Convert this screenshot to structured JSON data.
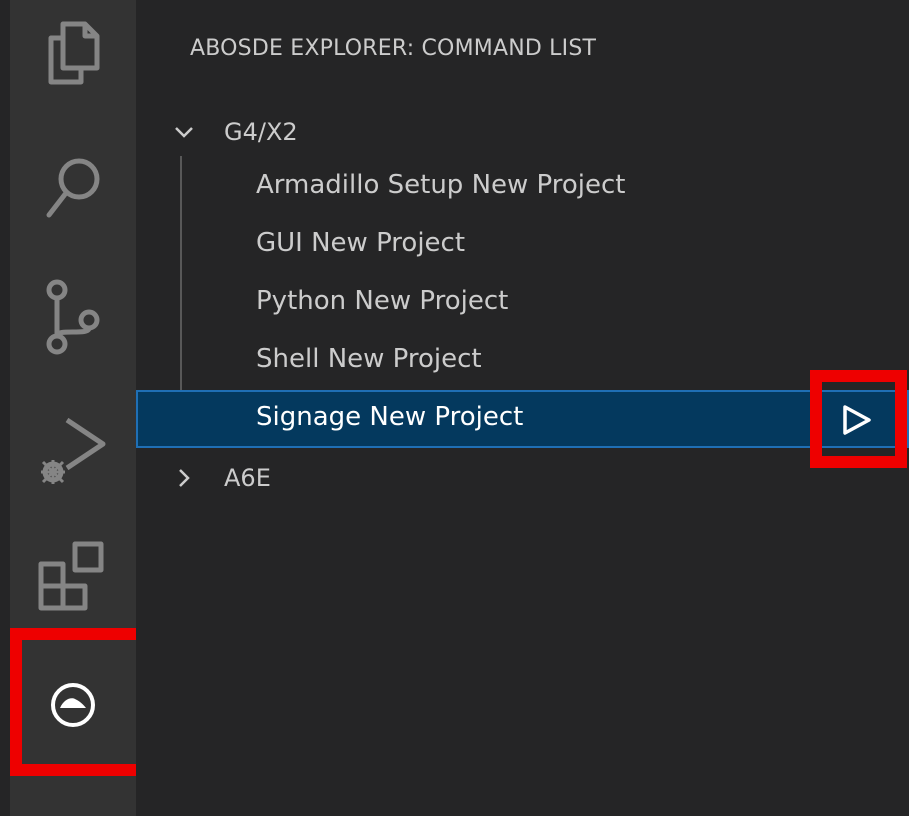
{
  "activity_bar": {
    "items": [
      {
        "icon": "explorer-icon"
      },
      {
        "icon": "search-icon"
      },
      {
        "icon": "source-control-icon"
      },
      {
        "icon": "run-debug-icon"
      },
      {
        "icon": "extensions-icon"
      },
      {
        "icon": "abosde-icon"
      }
    ]
  },
  "sidebar": {
    "title": "ABOSDE EXPLORER: COMMAND LIST",
    "groups": [
      {
        "label": "G4/X2",
        "expanded": true,
        "items": [
          {
            "label": "Armadillo Setup New Project"
          },
          {
            "label": "GUI New Project"
          },
          {
            "label": "Python New Project"
          },
          {
            "label": "Shell New Project"
          },
          {
            "label": "Signage New Project",
            "selected": true,
            "action_icon": "run-icon"
          }
        ]
      },
      {
        "label": "A6E",
        "expanded": false,
        "items": []
      }
    ]
  },
  "colors": {
    "highlight": "#ee0000",
    "selection_bg": "#04395e",
    "selection_border": "#1f6fb5",
    "activity_bar_bg": "#333333",
    "sidebar_bg": "#252526"
  }
}
